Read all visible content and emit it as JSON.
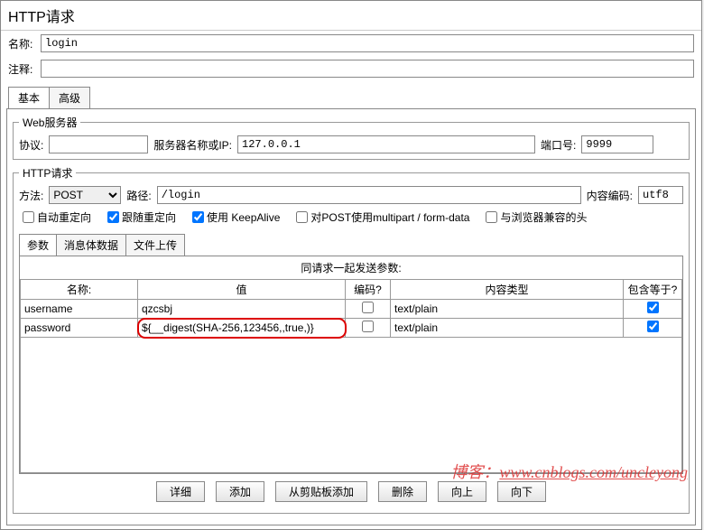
{
  "title": "HTTP请求",
  "labels": {
    "name": "名称:",
    "comment": "注释:"
  },
  "name_value": "login",
  "comment_value": "",
  "outer_tabs": {
    "basic": "基本",
    "advanced": "高级"
  },
  "webserver": {
    "legend": "Web服务器",
    "protocol_label": "协议:",
    "protocol_value": "",
    "server_label": "服务器名称或IP:",
    "server_value": "127.0.0.1",
    "port_label": "端口号:",
    "port_value": "9999"
  },
  "httpreq": {
    "legend": "HTTP请求",
    "method_label": "方法:",
    "method": "POST",
    "path_label": "路径:",
    "path_value": "/login",
    "encoding_label": "内容编码:",
    "encoding_value": "utf8"
  },
  "checks": {
    "auto_redirect": "自动重定向",
    "follow": "跟随重定向",
    "keepalive": "使用 KeepAlive",
    "multipart": "对POST使用multipart / form-data",
    "browser_headers": "与浏览器兼容的头"
  },
  "inner_tabs": {
    "params": "参数",
    "body": "消息体数据",
    "upload": "文件上传"
  },
  "params": {
    "title": "同请求一起发送参数:",
    "headers": {
      "name": "名称:",
      "value": "值",
      "encode": "编码?",
      "ctype": "内容类型",
      "include_eq": "包含等于?"
    },
    "rows": [
      {
        "name": "username",
        "value": "qzcsbj",
        "encode": false,
        "ctype": "text/plain",
        "include_eq": true,
        "highlight": false
      },
      {
        "name": "password",
        "value": "${__digest(SHA-256,123456,,true,)}",
        "encode": false,
        "ctype": "text/plain",
        "include_eq": true,
        "highlight": true
      }
    ]
  },
  "buttons": {
    "detail": "详细",
    "add": "添加",
    "clipboard": "从剪贴板添加",
    "delete": "删除",
    "up": "向上",
    "down": "向下"
  },
  "watermark": {
    "prefix": "博客：",
    "url": "www.cnblogs.com/uncleyong"
  }
}
